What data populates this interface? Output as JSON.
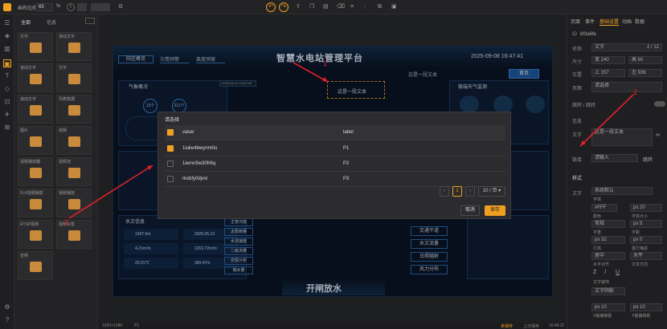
{
  "topbar": {
    "label": "画布比例",
    "zoom": "65",
    "zoom_unit": "%",
    "info_icon": "!"
  },
  "component_panel": {
    "tab_all": "全部",
    "tab_info": "信息",
    "cards": [
      "文字",
      "滚动文字",
      "滚动文字",
      "文字",
      "滚动文字",
      "列表数据",
      "图片",
      "视频",
      "视频播放器",
      "视频流",
      "FLV视频播放",
      "视频播放",
      "RTSP视频",
      "视频标签",
      "音频"
    ]
  },
  "screen": {
    "title": "智慧水电站管理平台",
    "datetime": "2025-09-08 16:47:41",
    "nav": [
      "防区概览",
      "灾情预警",
      "离度预案"
    ],
    "home_btn": "首页",
    "weather_title": "气象概况",
    "forecast_title": "极端天气监测",
    "hydro_title": "水文信息",
    "text_node": "这是一段文本",
    "text_node_top": "这是一段文本",
    "date_input": "2025-08-12 16:52:06",
    "side_labels": [
      "交通干道",
      "水文流量",
      "日照辐射",
      "风力分布"
    ],
    "mid_labels": [
      "主管河道",
      "太阳雨量",
      "水流速度",
      "二级流量",
      "灾情分析",
      "雨水量"
    ],
    "bottom_title": "开闸放水",
    "hydro_values": [
      "1347.6m",
      "2025.05.13",
      "4.21m³/s",
      "1263.72m³/s",
      "20.91℃",
      "369.47m"
    ],
    "weather_nums": [
      "13个",
      "211个"
    ]
  },
  "modal": {
    "title": "请选择",
    "col_value": "value",
    "col_label": "label",
    "rows": [
      {
        "value": "1iuke4bwynm0o",
        "label": "P1",
        "checked": true
      },
      {
        "value": "1iemn5w30fr6q",
        "label": "P2",
        "checked": false
      },
      {
        "value": "rkxbfy0djvxi",
        "label": "P3",
        "checked": false
      }
    ],
    "page": "1",
    "page_size": "10 / 页",
    "cancel": "取消",
    "save": "保存"
  },
  "right_panel": {
    "tabs": [
      "页面",
      "事件",
      "基础设置",
      "动画",
      "数据"
    ],
    "id_label": "ID",
    "id_value": "6f3a6fe",
    "name_label": "名称",
    "name_value": "文字",
    "page_counter": "2 / 12",
    "size_label": "尺寸",
    "w": "240",
    "h": "60",
    "pos_label": "位置",
    "x": "157",
    "y": "936",
    "page_select_label": "页面",
    "page_select": "请选择",
    "link_label": "跳转 / 跳转",
    "info_label": "信息",
    "text_label": "文字",
    "text_value": "这是一段文本",
    "link2_label": "链接",
    "link2_value": "请输入",
    "link2_btn": "跳转",
    "style_label": "样式",
    "font_label": "文字",
    "font_value": "系统默认",
    "font_sub": "字体",
    "color_value": "#FFF",
    "font_size": "20",
    "font_size_label": "字体大小",
    "color_label": "颜色",
    "weight_value": "常规",
    "weight_label": "字重",
    "spacing_value": "5",
    "spacing_label": "字距",
    "line_value": "32",
    "line_label": "行高",
    "indent_value": "0",
    "indent_label": "首行缩进",
    "align_value": "居中",
    "align_label": "水平对齐",
    "valign_value": "水平",
    "valign_label": "文本方向",
    "deco_label": "文字装饰",
    "shadow_label": "文字阴影",
    "x_off": "10",
    "y_off": "10",
    "x_off_label": "X轴偏移距",
    "y_off_label": "Y轴偏移距"
  },
  "annotations": [
    "1",
    "2",
    "3"
  ],
  "colors": {
    "accent": "#f0a020",
    "arrow": "#e3202a"
  },
  "bottombar": {
    "resolution": "1920×1080",
    "page": "P1",
    "status": "未保存",
    "sync": "上次保存",
    "time": "16:46:22"
  }
}
